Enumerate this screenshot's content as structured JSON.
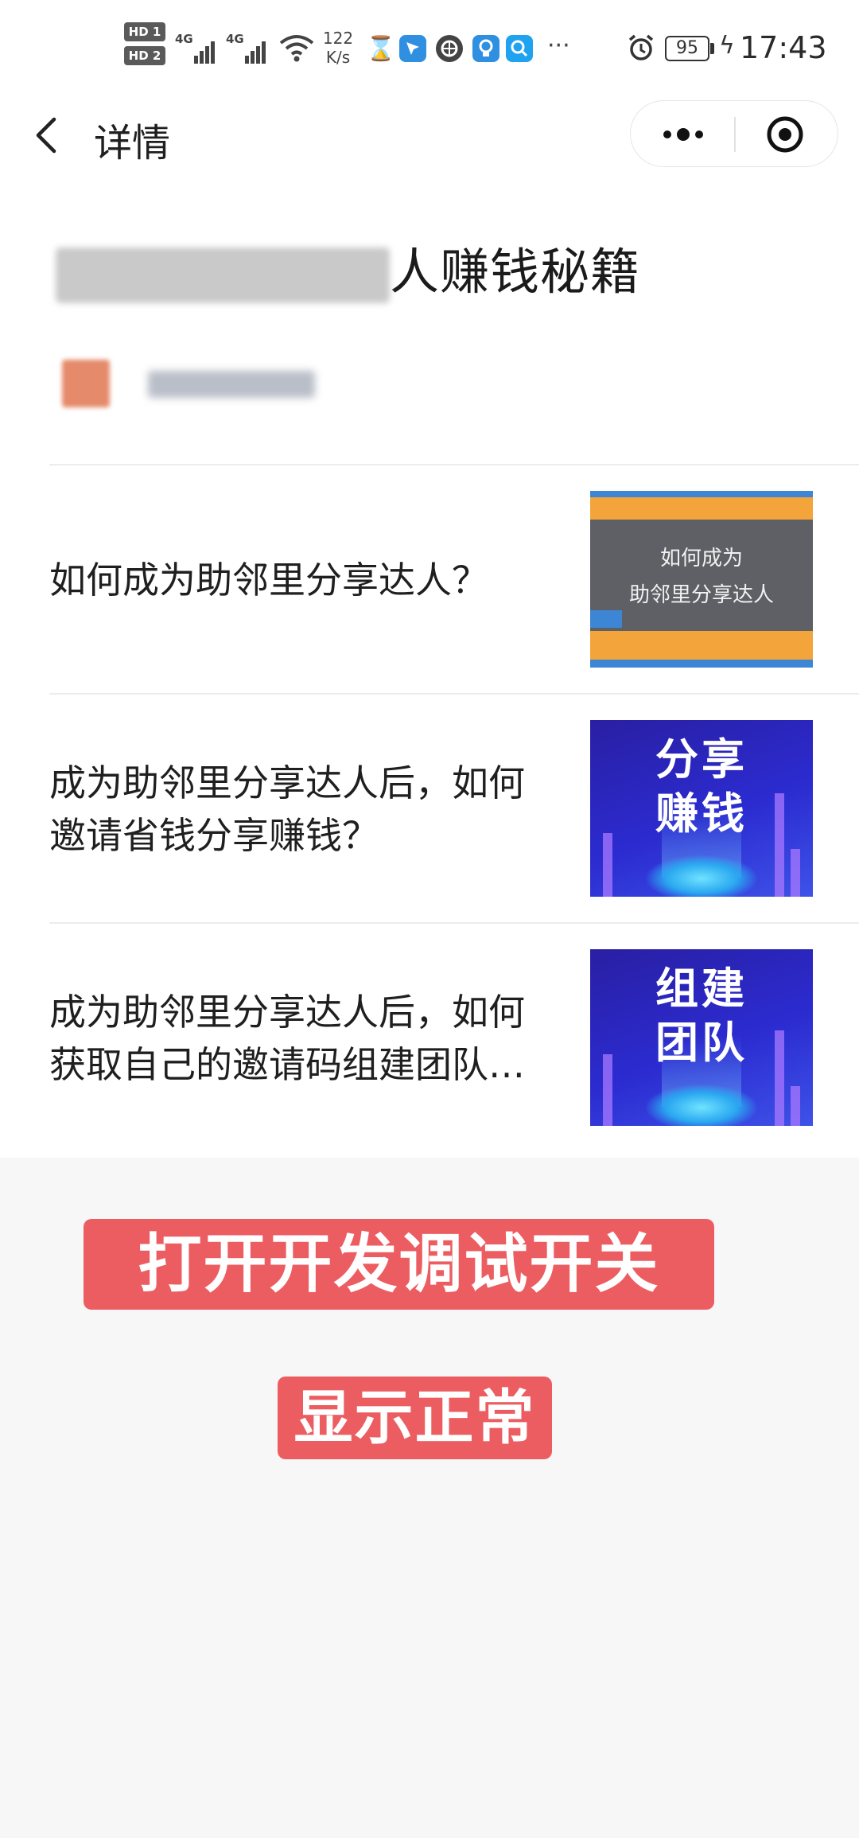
{
  "status_bar": {
    "hd1": "HD 1",
    "hd2": "HD 2",
    "net1": "4G",
    "net2": "4G",
    "speed_value": "122",
    "speed_unit": "K/s",
    "more": "···",
    "battery": "95",
    "time": "17:43"
  },
  "nav": {
    "title": "详情"
  },
  "article": {
    "title_visible": "人赚钱秘籍"
  },
  "list": [
    {
      "title": "如何成为助邻里分享达人？",
      "thumb_caption_line1": "如何成为",
      "thumb_caption_line2": "助邻里分享达人"
    },
    {
      "title": "成为助邻里分享达人后，如何邀请省钱分享赚钱？",
      "thumb_line1": "分享",
      "thumb_line2": "赚钱"
    },
    {
      "title": "成为助邻里分享达人后，如何获取自己的邀请码组建团队…",
      "thumb_line1": "组建",
      "thumb_line2": "团队"
    }
  ],
  "annotations": {
    "debug_label": "打开开发调试开关",
    "normal_label": "显示正常"
  },
  "colors": {
    "accent_red": "#ec5d61",
    "thumb_blue": "#2b2bd0",
    "thumb_orange": "#f3a43a"
  }
}
